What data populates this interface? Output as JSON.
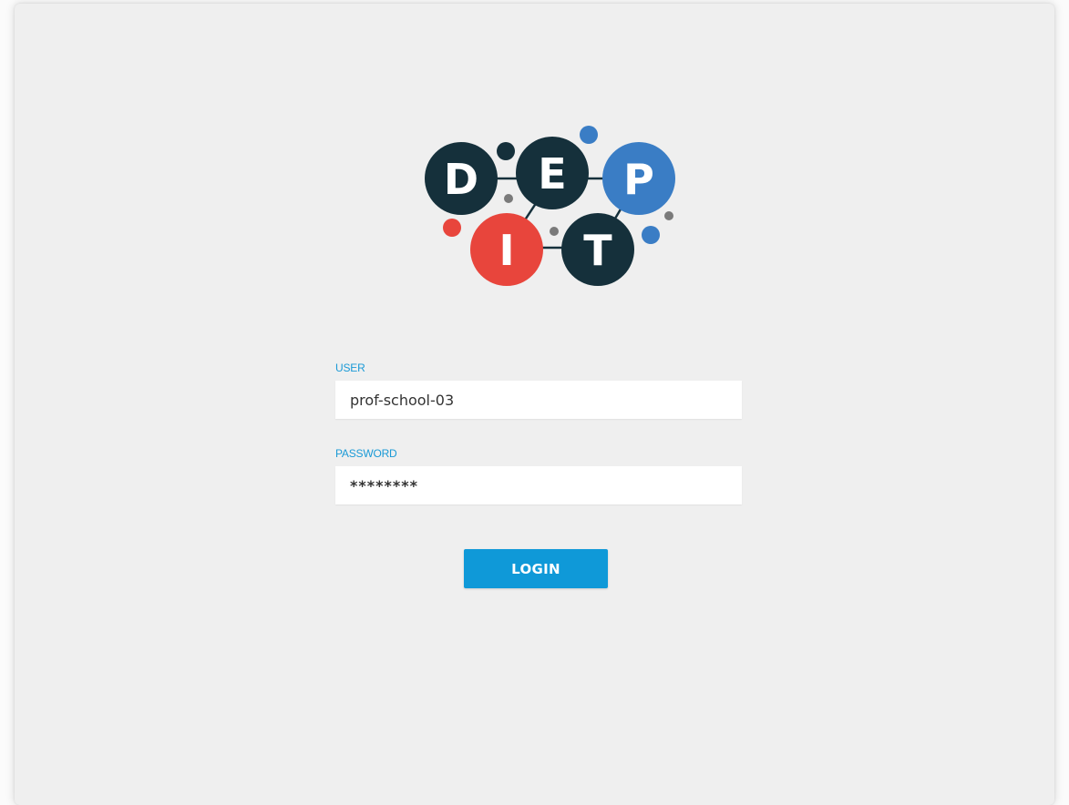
{
  "logo": {
    "letters": [
      "D",
      "E",
      "P",
      "I",
      "T"
    ],
    "colors": {
      "dark": "#15303b",
      "blue": "#3a7dc5",
      "red": "#e8453c",
      "gray": "#7a7a7a"
    }
  },
  "form": {
    "user_label": "USER",
    "user_value": "prof-school-03",
    "password_label": "PASSWORD",
    "password_value": "********"
  },
  "actions": {
    "login_label": "LOGIN"
  },
  "colors": {
    "accent": "#0f99d8",
    "background": "#efefef"
  }
}
